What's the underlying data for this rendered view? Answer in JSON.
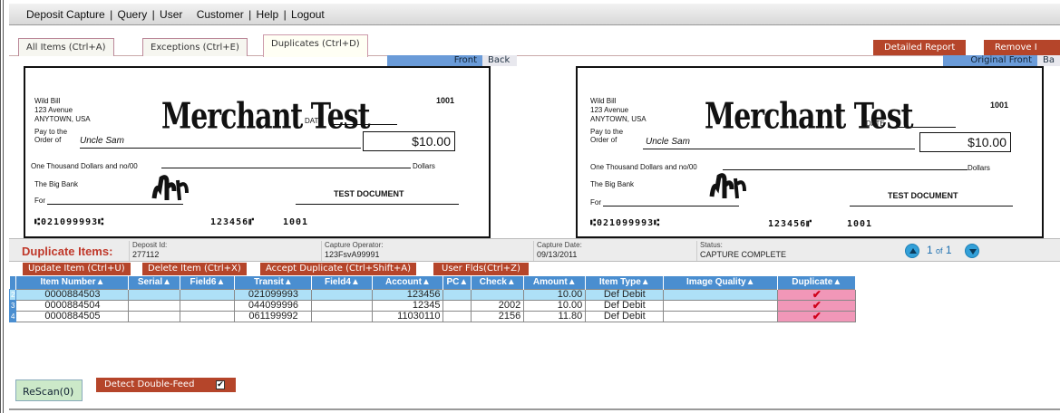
{
  "menu": {
    "items": [
      "Deposit Capture",
      "Query",
      "User",
      "Customer",
      "Help",
      "Logout"
    ],
    "separators": [
      "|",
      "|",
      "",
      "|",
      "|"
    ]
  },
  "tabs": [
    {
      "label": "All Items (Ctrl+A)"
    },
    {
      "label": "Exceptions (Ctrl+E)"
    },
    {
      "label": "Duplicates (Ctrl+D)"
    }
  ],
  "actions_top": {
    "detailed_report": "Detailed Report",
    "remove": "Remove I"
  },
  "view": {
    "left_front": "Front",
    "left_back": "Back",
    "right_original_front": "Original Front",
    "right_back": "Ba"
  },
  "check": {
    "name": "Wild Bill",
    "street": "123 Avenue",
    "city": "ANYTOWN, USA",
    "check_number": "1001",
    "date_label": "DATE",
    "pay_to_label_1": "Pay to the",
    "pay_to_label_2": "Order of",
    "payee": "Uncle Sam",
    "amount": "$10.00",
    "written_amount": "One Thousand Dollars and no/00",
    "dollars_label": "Dollars",
    "bank": "The Big Bank",
    "for_label": "For",
    "stamp": "TEST DOCUMENT",
    "logo_text": "Merchant Test",
    "micr_routing": "⑆021099993⑆",
    "micr_account": "123456⑈",
    "micr_serial": "1001"
  },
  "info": {
    "title": "Duplicate Items:",
    "deposit_id_label": "Deposit Id:",
    "deposit_id": "277112",
    "capture_operator_label": "Capture Operator:",
    "capture_operator": "123FsvA99991",
    "capture_date_label": "Capture Date:",
    "capture_date": "09/13/2011",
    "status_label": "Status:",
    "status": "CAPTURE COMPLETE",
    "page": "1",
    "of": "of",
    "total": "1"
  },
  "item_actions": [
    "Update Item (Ctrl+U)",
    "Delete Item (Ctrl+X)",
    "Accept Duplicate (Ctrl+Shift+A)",
    "User Flds(Ctrl+Z)"
  ],
  "grid": {
    "columns": [
      "Item Number",
      "Serial",
      "Field6",
      "Transit",
      "Field4",
      "Account",
      "PC",
      "Check",
      "Amount",
      "Item Type",
      "Image Quality",
      "Duplicate"
    ],
    "rows": [
      {
        "row": "2",
        "item_number": "0000884503",
        "serial": "",
        "field6": "",
        "transit": "021099993",
        "field4": "",
        "account": "123456",
        "pc": "",
        "check": "",
        "amount": "10.00",
        "item_type": "Def Debit",
        "image_quality": "",
        "duplicate": "✔",
        "selected": true
      },
      {
        "row": "3",
        "item_number": "0000884504",
        "serial": "",
        "field6": "",
        "transit": "044099996",
        "field4": "",
        "account": "12345",
        "pc": "",
        "check": "2002",
        "amount": "10.00",
        "item_type": "Def Debit",
        "image_quality": "",
        "duplicate": "✔",
        "selected": false
      },
      {
        "row": "4",
        "item_number": "0000884505",
        "serial": "",
        "field6": "",
        "transit": "061199992",
        "field4": "",
        "account": "11030110",
        "pc": "",
        "check": "2156",
        "amount": "11.80",
        "item_type": "Def Debit",
        "image_quality": "",
        "duplicate": "✔",
        "selected": false
      }
    ]
  },
  "bottom": {
    "rescan": "ReScan(0)",
    "detect_double_feed": "Detect Double-Feed",
    "detect_checked": "✔"
  },
  "colors": {
    "accent_red": "#b5452a",
    "grid_header": "#4a8ed0",
    "selected_row": "#aee0f7",
    "duplicate_cell": "#f197b8"
  }
}
